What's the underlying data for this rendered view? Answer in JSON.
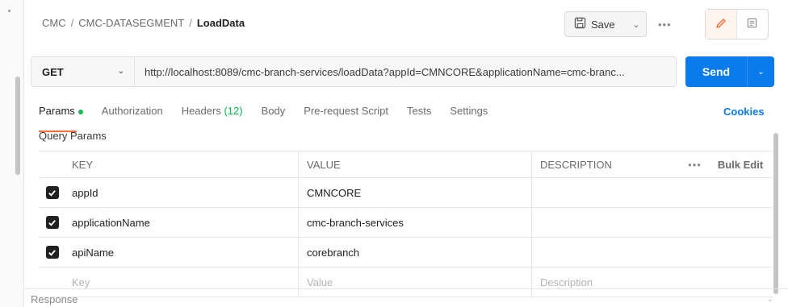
{
  "breadcrumb": {
    "workspace": "CMC",
    "collection": "CMC-DATASEGMENT",
    "request": "LoadData",
    "separator": "/"
  },
  "toolbar": {
    "save_label": "Save",
    "more_label": "•••"
  },
  "request": {
    "method": "GET",
    "url": "http://localhost:8089/cmc-branch-services/loadData?appId=CMNCORE&applicationName=cmc-branc...",
    "send_label": "Send"
  },
  "tabs": [
    {
      "label": "Params"
    },
    {
      "label": "Authorization"
    },
    {
      "label": "Headers",
      "count": "(12)"
    },
    {
      "label": "Body"
    },
    {
      "label": "Pre-request Script"
    },
    {
      "label": "Tests"
    },
    {
      "label": "Settings"
    }
  ],
  "cookies_label": "Cookies",
  "query_params": {
    "title": "Query Params",
    "headers": {
      "key": "KEY",
      "value": "VALUE",
      "description": "DESCRIPTION",
      "more": "•••",
      "bulk_edit": "Bulk Edit"
    },
    "rows": [
      {
        "key": "appId",
        "value": "CMNCORE",
        "description": "",
        "checked": true
      },
      {
        "key": "applicationName",
        "value": "cmc-branch-services",
        "description": "",
        "checked": true
      },
      {
        "key": "apiName",
        "value": "corebranch",
        "description": "",
        "checked": true
      }
    ],
    "placeholders": {
      "key": "Key",
      "value": "Value",
      "description": "Description"
    }
  },
  "response": {
    "label": "Response"
  },
  "colors": {
    "accent": "#ff6c37",
    "send": "#097bed",
    "active_dot": "#0cbb52"
  }
}
